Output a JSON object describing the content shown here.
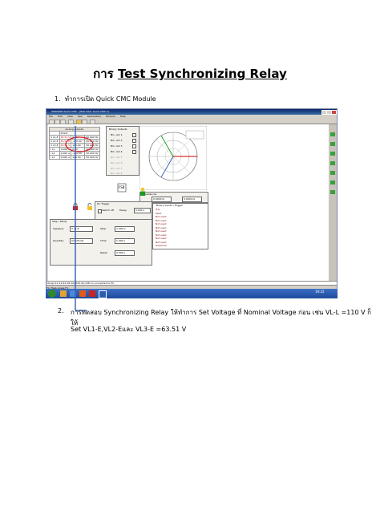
{
  "title": {
    "thai": "การ",
    "main": "Test Synchronizing Relay"
  },
  "step1": {
    "num": "1.",
    "thai": "ทำการเปิด",
    "text": "Quick CMC Module"
  },
  "step2": {
    "num": "2.",
    "line1": "การทดสอบ Synchronizing Relay ให้ทำการ Set Voltage ที่ Nominal Voltage ก่อน เช่น VL-L =110 V ก็ให้",
    "line2": "Set VL1-E,VL2-Eและ VL3-E =63.51 V"
  },
  "app": {
    "window_title": "OMICRON Quick CMC - [Test View: Quick CMC 1]",
    "menu": [
      "File",
      "Edit",
      "View",
      "Test",
      "Parameters",
      "Window",
      "Help"
    ],
    "analog_outputs": {
      "header": "Analog outputs",
      "sub": "Direct",
      "rows": [
        [
          "V L1-E",
          "63.51 V",
          "0.00 °",
          "50.000 Hz"
        ],
        [
          "V L2-E",
          "63.51 V",
          "-120.00 °",
          "50.000 Hz"
        ],
        [
          "V L3-E",
          "63.51 V",
          "120.00 °",
          "50.000 Hz"
        ],
        [
          "I L1",
          "0.000 A",
          "0.00 °",
          "50.000 Hz"
        ],
        [
          "I L2",
          "0.000 A",
          "-120.00 °",
          "50.000 Hz"
        ],
        [
          "I L3",
          "0.000 A",
          "120.00 °",
          "50.000 Hz"
        ]
      ]
    },
    "binary_outputs": {
      "header": "Binary Outputs",
      "items": [
        "Bin. out 1",
        "Bin. out 2",
        "Bin. out 3",
        "Bin. out 4",
        "Bin. out 5",
        "Bin. out 6",
        "Bin. out 7",
        "Bin. out 8"
      ]
    },
    "impedance": {
      "label": "Impedances",
      "r": "0.0000 Ω",
      "x": "0.0000 Ω"
    },
    "on_trigger": {
      "label": "On Trigger",
      "switch_off": "Switch off",
      "delay_label": "Delay:",
      "delay_value": "0.000 s"
    },
    "step_ramp": {
      "label": "Step / Ramp",
      "signal_label": "Signal(s):",
      "signal_value": "V L1-E",
      "quantity_label": "Quantity:",
      "quantity_value": "Amplitude",
      "step_label": "Step:",
      "step_value": "1.000 V",
      "time_label": "Time:",
      "time_value": "1.000 s",
      "reset_label": "Reset:",
      "reset_value": "0.000 s"
    },
    "binary_inputs": {
      "header": "Binary inputs / Trigger",
      "rows": [
        "Trip",
        "Start",
        "Not used",
        "Not used",
        "Not used",
        "Not used",
        "Not used",
        "Not used",
        "Not used",
        "Not used",
        "Overload"
      ]
    },
    "status_line": "19-Apr-10 19:22:28 XXXXXX No CMC is connected to PC.",
    "status_bar": "For Help, press F1",
    "clock": "19:22"
  },
  "colors": {
    "accent": "#d11b1b",
    "arrow": "#2f5fb3",
    "titlebar": "#0a246a",
    "windows_start": "#1a4fa0"
  }
}
